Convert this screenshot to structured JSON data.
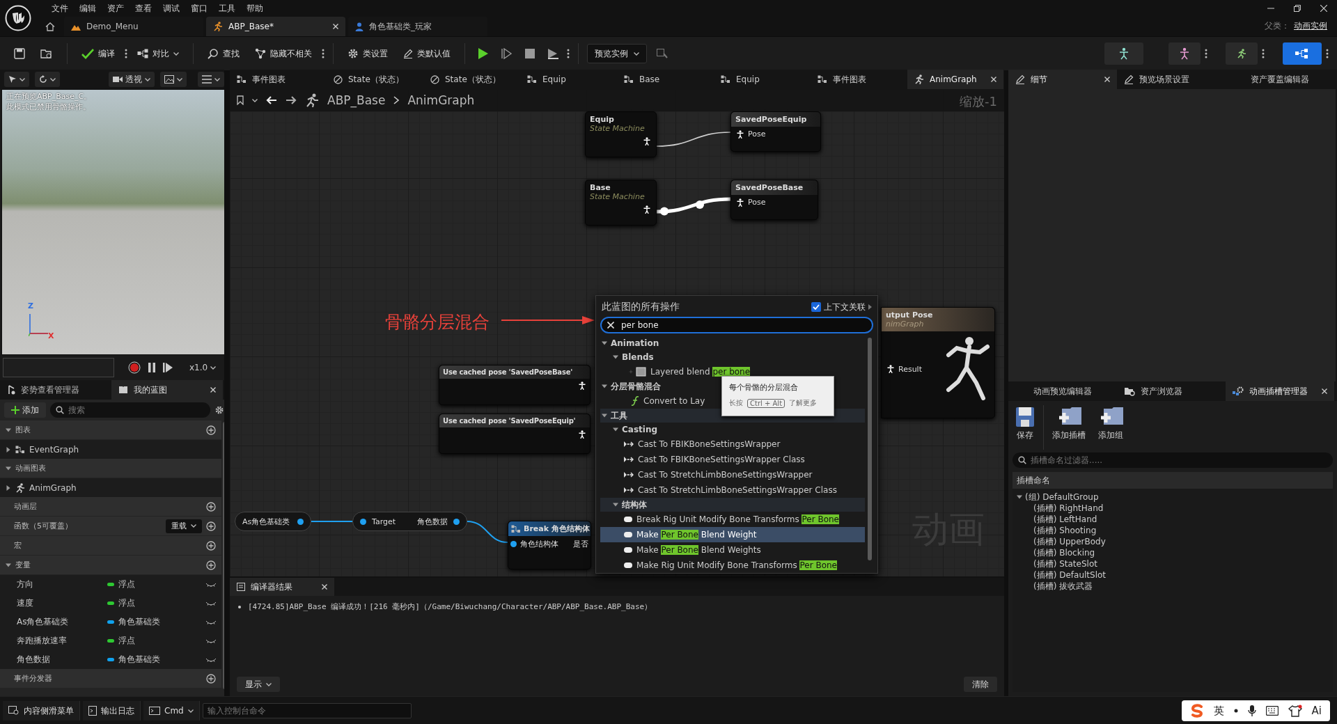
{
  "app": {
    "menus": [
      "文件",
      "编辑",
      "资产",
      "查看",
      "调试",
      "窗口",
      "工具",
      "帮助"
    ],
    "doc_tabs": [
      {
        "kind": "level",
        "label": "Demo_Menu",
        "selected": false
      },
      {
        "kind": "anim",
        "label": "ABP_Base*",
        "selected": true
      },
      {
        "kind": "blueprint",
        "label": "角色基础类_玩家",
        "selected": false
      }
    ],
    "parent_class": {
      "label": "父类：",
      "value": "动画实例"
    }
  },
  "toolbar": {
    "items": [
      {
        "kind": "compile",
        "label": "编译",
        "more": true,
        "dropdown": false
      },
      {
        "kind": "diff",
        "label": "对比",
        "more": false,
        "dropdown": true
      },
      {
        "kind": "find",
        "label": "查找",
        "more": false,
        "dropdown": false
      },
      {
        "kind": "hide",
        "label": "隐藏不相关",
        "more": true,
        "dropdown": false
      },
      {
        "kind": "settings",
        "label": "类设置",
        "more": false,
        "dropdown": false
      },
      {
        "kind": "defaults",
        "label": "类默认值",
        "more": false,
        "dropdown": false
      }
    ],
    "preview_instance": "预览实例"
  },
  "viewport": {
    "view_mode": "透视",
    "overlay_lines": [
      "正在预览ABP_Base_C。",
      "此模式已禁用骨骼操作。"
    ],
    "axis_labels": [
      "Z",
      "X"
    ],
    "play_rate": "x1.0"
  },
  "my_blueprint": {
    "tabs": [
      {
        "label": "姿势查看管理器",
        "selected": false
      },
      {
        "label": "我的蓝图",
        "selected": true
      }
    ],
    "add": "添加",
    "search_placeholder": "搜索",
    "rows": [
      {
        "kind": "group",
        "label": "图表",
        "expanded": true,
        "addable": true
      },
      {
        "kind": "event_graph",
        "label": "EventGraph",
        "expanded": false
      },
      {
        "kind": "group",
        "label": "动画图表",
        "expanded": true,
        "addable": false
      },
      {
        "kind": "anim_graph",
        "label": "AnimGraph",
        "expanded": false
      },
      {
        "kind": "section",
        "label": "动画层"
      },
      {
        "kind": "section",
        "label": "函数（5可覆盖）",
        "override": "重载"
      },
      {
        "kind": "section",
        "label": "宏"
      },
      {
        "kind": "group",
        "label": "变量",
        "expanded": true,
        "addable": true
      },
      {
        "kind": "variable",
        "label": "方向",
        "type": "浮点",
        "color": "#2ec832"
      },
      {
        "kind": "variable",
        "label": "速度",
        "type": "浮点",
        "color": "#2ec832"
      },
      {
        "kind": "variable",
        "label": "As角色基础类",
        "type": "角色基础类",
        "color": "#10a2ee"
      },
      {
        "kind": "variable",
        "label": "奔跑播放速率",
        "type": "浮点",
        "color": "#2ec832"
      },
      {
        "kind": "variable",
        "label": "角色数据",
        "type": "角色基础类",
        "color": "#10a2ee"
      },
      {
        "kind": "section",
        "label": "事件分发器"
      }
    ]
  },
  "graph": {
    "tabs": [
      {
        "kind": "graph",
        "label": "事件图表",
        "selected": false
      },
      {
        "kind": "state",
        "label": "State（状态）",
        "selected": false
      },
      {
        "kind": "state",
        "label": "State（状态）",
        "selected": false
      },
      {
        "kind": "graph",
        "label": "Equip",
        "selected": false
      },
      {
        "kind": "graph",
        "label": "Base",
        "selected": false
      },
      {
        "kind": "graph",
        "label": "Equip",
        "selected": false
      },
      {
        "kind": "graph",
        "label": "事件图表",
        "selected": false
      },
      {
        "kind": "anim",
        "label": "AnimGraph",
        "selected": true
      }
    ],
    "breadcrumb": [
      "ABP_Base",
      "AnimGraph"
    ],
    "zoom": "缩放-1",
    "watermark": "动画",
    "nodes": [
      {
        "kind": "state_machine",
        "title": "Equip",
        "subtitle": "State Machine"
      },
      {
        "kind": "saved_pose",
        "title": "SavedPoseEquip",
        "pin": "Pose"
      },
      {
        "kind": "state_machine",
        "title": "Base",
        "subtitle": "State Machine"
      },
      {
        "kind": "saved_pose",
        "title": "SavedPoseBase",
        "pin": "Pose"
      },
      {
        "kind": "cached_pose",
        "title": "Use cached pose 'SavedPoseBase'"
      },
      {
        "kind": "cached_pose",
        "title": "Use cached pose 'SavedPoseEquip'"
      },
      {
        "kind": "output_pose",
        "title": "utput Pose",
        "subtitle": "nimGraph",
        "pin": "Result"
      },
      {
        "kind": "variable",
        "label": "As角色基础类"
      },
      {
        "kind": "getter",
        "input": "Target",
        "output": "角色数据"
      },
      {
        "kind": "break",
        "title": "Break 角色结构体",
        "pins": [
          "角色结构体",
          "是否"
        ]
      }
    ],
    "annotation": "骨骼分层混合",
    "action_menu": {
      "title": "此蓝图的所有操作",
      "context": {
        "label": "上下文关联",
        "checked": true
      },
      "search": "per bone",
      "items": [
        {
          "kind": "category",
          "label": "Animation",
          "expanded": true,
          "children": [
            {
              "kind": "category",
              "label": "Blends",
              "expanded": true,
              "children": [
                {
                  "kind": "blend",
                  "text": "Layered blend ",
                  "match": "per bone",
                  "selected": false
                }
              ]
            }
          ]
        },
        {
          "kind": "category",
          "label": "分层骨骼混合",
          "expanded": true,
          "children": [
            {
              "kind": "function",
              "text": "Convert to Lay",
              "selected": false
            }
          ]
        },
        {
          "kind": "category",
          "label": "工具",
          "expanded": true,
          "children": [
            {
              "kind": "category",
              "label": "Casting",
              "expanded": true,
              "children": [
                {
                  "kind": "cast",
                  "text": "Cast To FBIKBoneSettingsWrapper",
                  "selected": false
                },
                {
                  "kind": "cast",
                  "text": "Cast To FBIKBoneSettingsWrapper Class",
                  "selected": false
                },
                {
                  "kind": "cast",
                  "text": "Cast To StretchLimbBoneSettingsWrapper",
                  "selected": false
                },
                {
                  "kind": "cast",
                  "text": "Cast To StretchLimbBoneSettingsWrapper Class",
                  "selected": false
                }
              ]
            },
            {
              "kind": "category",
              "label": "结构体",
              "expanded": true,
              "children": [
                {
                  "kind": "struct",
                  "text": "Break Rig Unit Modify Bone Transforms ",
                  "match": "Per Bone",
                  "selected": false
                },
                {
                  "kind": "struct",
                  "text": "Make ",
                  "match": "Per Bone",
                  "after": " Blend Weight",
                  "selected": true
                },
                {
                  "kind": "struct",
                  "text": "Make ",
                  "match": "Per Bone",
                  "after": " Blend Weights",
                  "selected": false
                },
                {
                  "kind": "struct",
                  "text": "Make Rig Unit Modify Bone Transforms ",
                  "match": "Per Bone",
                  "selected": false
                }
              ]
            }
          ]
        }
      ]
    },
    "tooltip": {
      "title": "每个骨骼的分层混合",
      "hint": "长按",
      "shortcut": "Ctrl + Alt",
      "more": "了解更多"
    }
  },
  "compiler": {
    "tab": "编译器结果",
    "messages": [
      "[4724.85]ABP_Base 编译成功！[216 毫秒内]（/Game/Biwuchang/Character/ABP/ABP_Base.ABP_Base）"
    ],
    "show": "显示",
    "clear": "清除"
  },
  "right": {
    "top_tabs": [
      {
        "kind": "details",
        "label": "细节",
        "selected": true
      },
      {
        "kind": "scene",
        "label": "预览场景设置",
        "selected": false
      },
      {
        "kind": "plain",
        "label": "资产覆盖编辑器",
        "selected": false
      }
    ],
    "bottom_tabs": [
      {
        "kind": "plain",
        "label": "动画预览编辑器",
        "selected": false
      },
      {
        "kind": "browser",
        "label": "资产浏览器",
        "selected": false
      },
      {
        "kind": "slots",
        "label": "动画插槽管理器",
        "selected": true
      }
    ],
    "tools": [
      {
        "kind": "save",
        "label": "保存"
      },
      {
        "kind": "add_slot",
        "label": "添加插槽"
      },
      {
        "kind": "add_group",
        "label": "添加组"
      }
    ],
    "filter_placeholder": "插槽命名过滤器.....",
    "column": "插槽命名",
    "slots": [
      {
        "label": "(组) DefaultGroup",
        "expanded": true,
        "children": [
          {
            "label": "(插槽) RightHand"
          },
          {
            "label": "(插槽) LeftHand"
          },
          {
            "label": "(插槽) Shooting"
          },
          {
            "label": "(插槽) UpperBody"
          },
          {
            "label": "(插槽) Blocking"
          },
          {
            "label": "(插槽) StateSlot"
          },
          {
            "label": "(插槽) DefaultSlot"
          },
          {
            "label": "(插槽) 拔收武器"
          }
        ]
      }
    ]
  },
  "status": {
    "buttons": [
      {
        "kind": "drawer",
        "label": "内容侧滑菜单"
      },
      {
        "kind": "log",
        "label": "输出日志"
      }
    ],
    "cmd": "Cmd",
    "console_placeholder": "输入控制台命令",
    "ime": {
      "mode": "英",
      "ai": "Ai"
    }
  }
}
